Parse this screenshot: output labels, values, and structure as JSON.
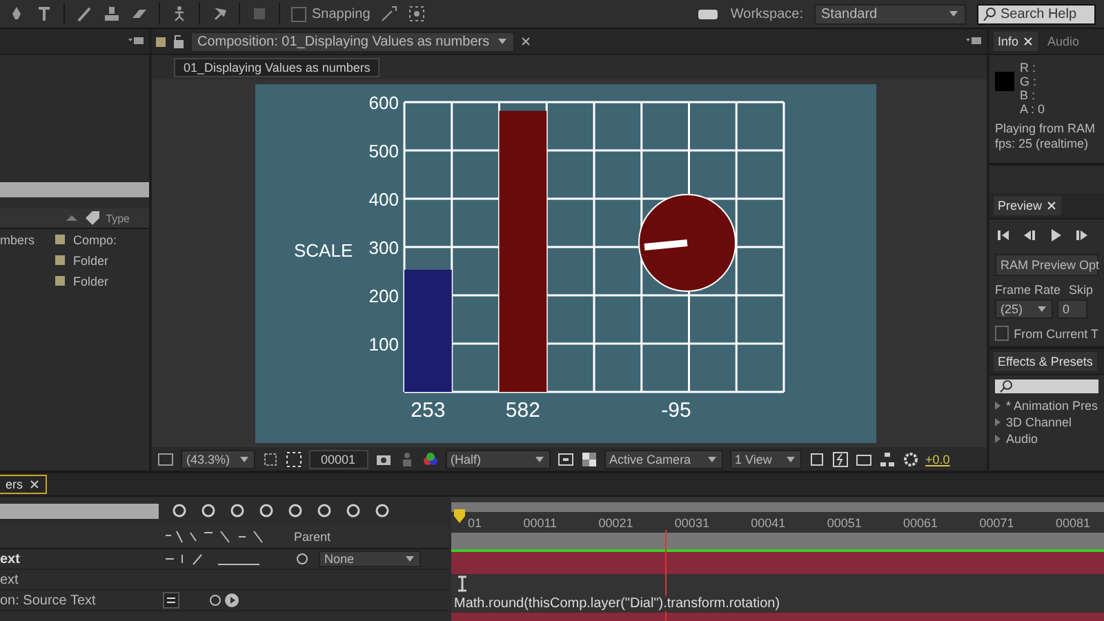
{
  "toolbar": {
    "snapping": {
      "label": "Snapping",
      "checked": false
    },
    "workspace_label": "Workspace:",
    "workspace": "Standard",
    "search_placeholder": "Search Help"
  },
  "project": {
    "columns": [
      {
        "label": "Type"
      }
    ],
    "rows": [
      {
        "name": "mbers",
        "type": "Compo:"
      },
      {
        "type": "Folder"
      },
      {
        "type": "Folder"
      }
    ]
  },
  "composition": {
    "tab": "Composition: 01_Displaying Values as numbers",
    "breadcrumb": "01_Displaying Values as numbers",
    "scale_label": "SCALE",
    "chart_data": {
      "type": "bar",
      "categories": [
        null,
        null,
        null,
        null,
        null,
        null,
        null,
        null
      ],
      "values": [
        253,
        null,
        582,
        null,
        null,
        null,
        null,
        null
      ],
      "ylim": [
        0,
        600
      ],
      "yticks": [
        100,
        200,
        300,
        400,
        500,
        600
      ],
      "grid": true,
      "value_labels": [
        "253",
        null,
        "582",
        null,
        null,
        null,
        null,
        null
      ]
    },
    "dial_reading": "-95",
    "viewer": {
      "zoom": "(43.3%)",
      "timecode": "00001",
      "resolution": "(Half)",
      "camera": "Active Camera",
      "views": "1 View",
      "exposure": "+0.0"
    }
  },
  "info": {
    "tabs": [
      {
        "label": "Info",
        "selected": true
      },
      {
        "label": "Audio",
        "selected": false
      }
    ],
    "channels": [
      "R :",
      "G :",
      "B :",
      "A : 0"
    ],
    "status": [
      "Playing from RAM",
      "fps: 25 (realtime)"
    ]
  },
  "preview": {
    "tab": "Preview",
    "options_label": "RAM Preview Opt",
    "frame_rate_label": "Frame Rate",
    "skip_label": "Skip",
    "frame_rate": "(25)",
    "skip": "0",
    "from_current": {
      "label": "From Current T",
      "checked": false
    }
  },
  "effects": {
    "tab": "Effects & Presets",
    "items": [
      "* Animation Pres",
      "3D Channel",
      "Audio"
    ]
  },
  "timeline": {
    "tab": "ers",
    "ruler": [
      "01",
      "00011",
      "00021",
      "00031",
      "00041",
      "00051",
      "00061",
      "00071",
      "00081"
    ],
    "parent_header": "Parent",
    "layers": [
      {
        "kind": "layer",
        "name": "ext",
        "parent": "None"
      },
      {
        "kind": "property",
        "name": "ext"
      },
      {
        "kind": "expression",
        "name": "on: Source Text",
        "expression": "Math.round(thisComp.layer(\"Dial\").transform.rotation)"
      }
    ]
  }
}
